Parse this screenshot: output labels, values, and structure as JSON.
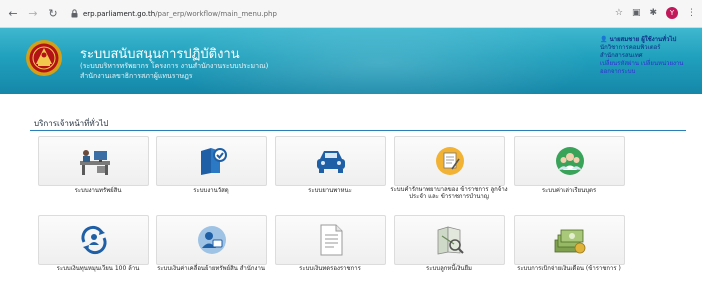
{
  "browser": {
    "url_host": "erp.parliament.go.th",
    "url_path": "/par_erp/workflow/main_menu.php",
    "profile_initial": "Y"
  },
  "header": {
    "title": "ระบบสนับสนุนการปฏิบัติงาน",
    "subtitle_1": "(ระบบบริหารทรัพยากร โครงการ งานสำนักงานระบบประมาณ)",
    "subtitle_2": "สำนักงานเลขาธิการสภาผู้แทนราษฎร",
    "user_name": "นายสมชาย ผู้ใช้งานทั่วไป",
    "user_role_1": "นักวิชาการคอมพิวเตอร์",
    "user_role_2": "สำนักสารสนเทศ",
    "user_links": "เปลี่ยนรหัสผ่าน  เปลี่ยนหน่วยงาน",
    "user_links_2": "ออกจากระบบ"
  },
  "section": {
    "title": "บริการเจ้าหน้าที่ทั่วไป"
  },
  "tiles": [
    {
      "label": "ระบบงานทรัพย์สิน",
      "icon": "desk-computer-icon"
    },
    {
      "label": "ระบบงานวัสดุ",
      "icon": "documents-check-icon"
    },
    {
      "label": "ระบบยานพาหนะ",
      "icon": "car-icon"
    },
    {
      "label": "ระบบคำรักษาพยาบาลของ ข้าราชการ ลูกจ้างประจำ และ ข้าราชการบำนาญ",
      "icon": "health-document-icon"
    },
    {
      "label": "ระบบค่าเล่าเรียนบุตร",
      "icon": "group-people-icon"
    },
    {
      "label": "ระบบเงินทุนหมุนเวียน 100 ล้าน",
      "icon": "revolving-fund-icon"
    },
    {
      "label": "ระบบเงินค่าเคลื่อนย้ายทรัพย์สิน สำนักงาน",
      "icon": "person-card-icon"
    },
    {
      "label": "ระบบเงินทดรองราชการ",
      "icon": "text-document-icon"
    },
    {
      "label": "ระบบลูกหนี้เงินยืม",
      "icon": "map-document-icon"
    },
    {
      "label": "ระบบการเบิกจ่ายเงินเดือน (ข้าราชการ )",
      "icon": "money-stack-icon"
    }
  ],
  "colors": {
    "banner_top": "#3fb7cf",
    "banner_bottom": "#1687a8",
    "section_rule": "#2a7fb8"
  }
}
